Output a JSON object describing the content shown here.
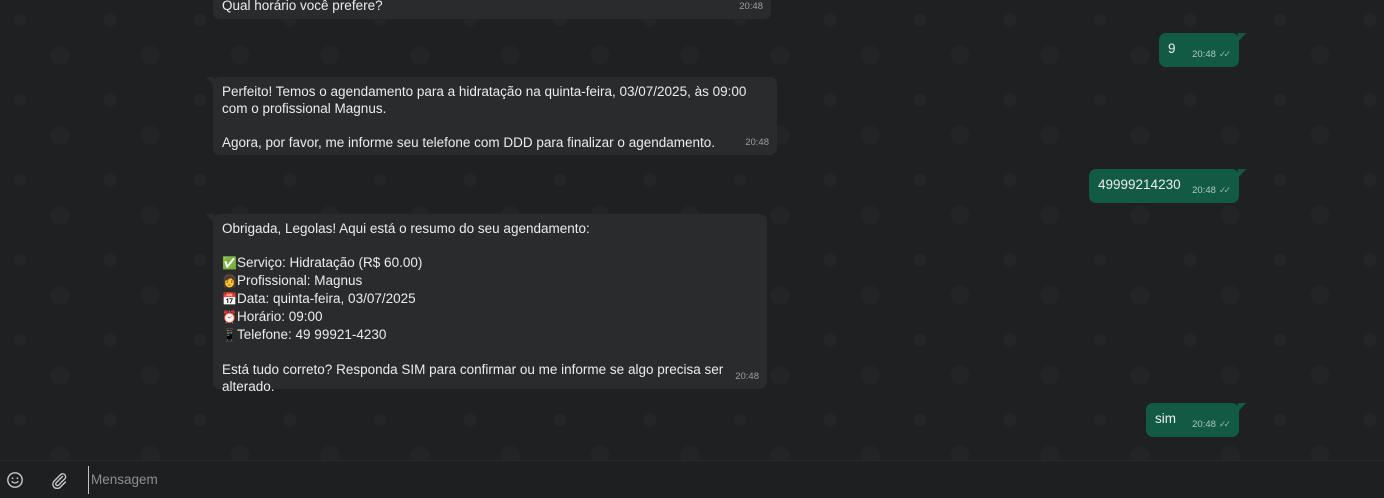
{
  "messages": [
    {
      "id": "m1",
      "text": "Qual horário você prefere?",
      "time": "20:48"
    },
    {
      "id": "m2",
      "text": "9",
      "time": "20:48"
    },
    {
      "id": "m3",
      "text": "Perfeito! Temos o agendamento para a hidratação na quinta-feira, 03/07/2025, às 09:00 com o profissional Magnus.\n\nAgora, por favor, me informe seu telefone com DDD para finalizar o agendamento.",
      "time": "20:48"
    },
    {
      "id": "m4",
      "text": "49999214230",
      "time": "20:48"
    },
    {
      "id": "m5",
      "intro": "Obrigada, Legolas! Aqui está o resumo do seu agendamento:",
      "lines": [
        {
          "icon": "✅",
          "text": "Serviço: Hidratação (R$ 60.00)"
        },
        {
          "icon": "👩",
          "text": "Profissional: Magnus"
        },
        {
          "icon": "📅",
          "text": "Data: quinta-feira, 03/07/2025"
        },
        {
          "icon": "⏰",
          "text": "Horário: 09:00"
        },
        {
          "icon": "📱",
          "text": "Telefone: 49 99921-4230"
        }
      ],
      "outro": "Está tudo correto? Responda SIM para confirmar ou me informe se algo precisa ser alterado.",
      "time": "20:48"
    },
    {
      "id": "m6",
      "text": "sim",
      "time": "20:48"
    }
  ],
  "status": {
    "read_ticks": "✓✓"
  },
  "composer": {
    "placeholder": "Mensagem"
  },
  "icons": {
    "emoji": "emoji-icon",
    "attach": "paperclip-icon"
  }
}
